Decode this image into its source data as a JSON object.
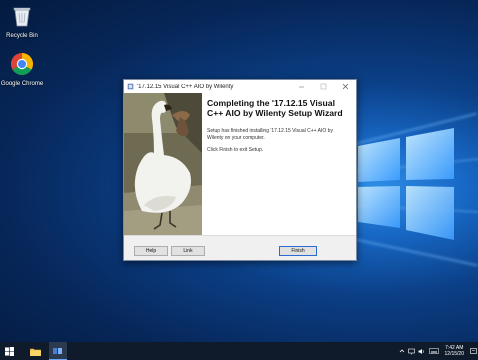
{
  "desktop": {
    "icons": [
      {
        "label": "Recycle Bin",
        "icon": "recycle-bin-icon"
      },
      {
        "label": "Google Chrome",
        "icon": "chrome-icon"
      }
    ]
  },
  "dialog": {
    "title": "'17.12.15 Visual C++ AIO by Wilenty",
    "heading": "Completing the '17.12.15 Visual C++ AIO by Wilenty Setup Wizard",
    "message1": "Setup has finished installing '17.12.15 Visual C++ AIO by Wilenty on your computer.",
    "message2": "Click Finish to exit Setup.",
    "buttons": {
      "help": "Help",
      "link": "Link",
      "finish": "Finish"
    },
    "side_image": "swan-photo"
  },
  "taskbar": {
    "items": [
      "start-icon",
      "file-explorer-icon",
      "setup-app-icon"
    ],
    "tray_icons": [
      "chevron-up-icon",
      "network-icon",
      "volume-icon",
      "keyboard-icon"
    ],
    "time": "7:42 AM",
    "date": "12/15/20"
  },
  "colors": {
    "accent": "#2a6ad4",
    "taskbar": "#0f1a2b"
  }
}
